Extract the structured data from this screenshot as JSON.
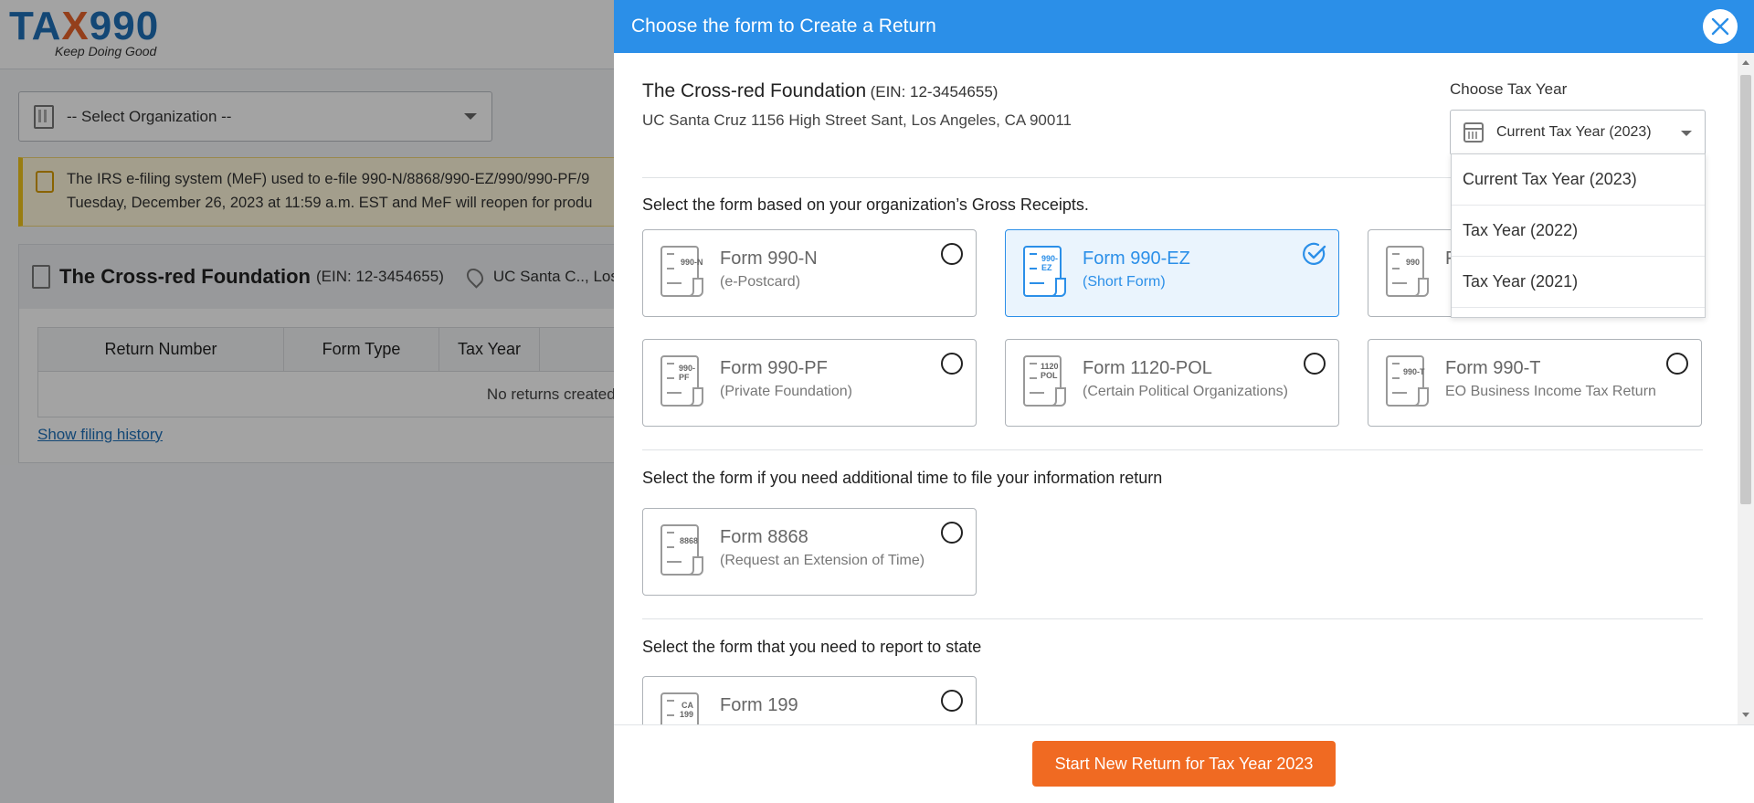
{
  "bg": {
    "logo": {
      "brand_a": "TA",
      "brand_x": "X",
      "brand_b": "990",
      "tagline": "Keep Doing Good"
    },
    "org_select": {
      "placeholder": "-- Select Organization --"
    },
    "notice": {
      "line1": "The IRS e-filing system (MeF) used to e-file 990-N/8868/990-EZ/990/990-PF/9",
      "line2": "Tuesday, December 26, 2023 at 11:59 a.m. EST and MeF will reopen for produ"
    },
    "org_card": {
      "name": "The Cross-red Foundation",
      "ein": "(EIN: 12-3454655)",
      "address": "UC Santa C.., Los A",
      "columns": [
        "Return Number",
        "Form Type",
        "Tax Year"
      ],
      "empty_message": "No returns created. Click",
      "history_link": "Show filing history"
    }
  },
  "modal": {
    "title": "Choose the form to Create a Return",
    "org_name": "The Cross-red Foundation",
    "org_ein": "(EIN: 12-3454655)",
    "org_address": "UC Santa Cruz 1156 High Street Sant, Los Angeles, CA 90011",
    "tax_year_label": "Choose Tax Year",
    "tax_year_selected": "Current Tax Year (2023)",
    "tax_year_options": [
      "Current Tax Year (2023)",
      "Tax Year (2022)",
      "Tax Year (2021)"
    ],
    "section_gross": "Select the form based on your organization’s Gross Receipts.",
    "section_extension": "Select the form if you need additional time to file your information return",
    "section_state": "Select the form that you need to report to state",
    "forms": [
      {
        "title": "Form 990-N",
        "subtitle": "(e-Postcard)",
        "icon_text": "990-N",
        "selected": false
      },
      {
        "title": "Form 990-EZ",
        "subtitle": "(Short Form)",
        "icon_text": "990-EZ",
        "selected": true
      },
      {
        "title": "F",
        "subtitle": "",
        "icon_text": "990",
        "selected": false
      },
      {
        "title": "Form 990-PF",
        "subtitle": "(Private Foundation)",
        "icon_text": "990-PF",
        "selected": false
      },
      {
        "title": "Form 1120-POL",
        "subtitle": "(Certain Political Organizations)",
        "icon_text": "1120 POL",
        "selected": false
      },
      {
        "title": "Form 990-T",
        "subtitle": "EO Business Income Tax Return",
        "icon_text": "990-T",
        "selected": false
      },
      {
        "title": "Form 8868",
        "subtitle": "(Request an Extension of Time)",
        "icon_text": "8868",
        "selected": false
      },
      {
        "title": "Form 199",
        "subtitle": "",
        "icon_text": "CA 199",
        "selected": false
      }
    ],
    "start_button": "Start New Return for Tax Year 2023"
  },
  "colors": {
    "header_blue": "#2b8fe8",
    "button_orange": "#f06a22",
    "logo_blue": "#1e6fb8"
  }
}
